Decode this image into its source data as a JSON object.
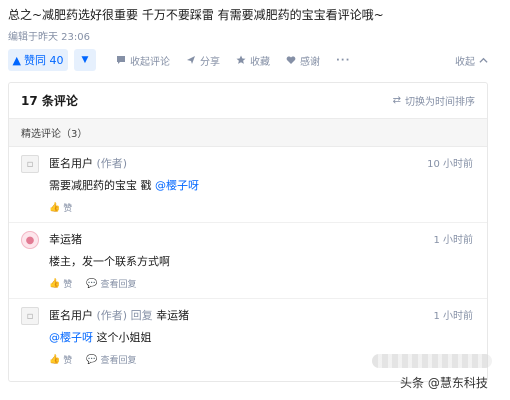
{
  "post": {
    "text": "总之~减肥药选好很重要 千万不要踩雷 有需要减肥药的宝宝看评论哦~",
    "edit_time": "编辑于昨天 23:06"
  },
  "actions": {
    "vote_up": "赞同 40",
    "vote_up_icon": "▲",
    "vote_down_icon": "▼",
    "comment": "收起评论",
    "share": "分享",
    "favorite": "收藏",
    "thanks": "感谢",
    "more": "···",
    "collapse": "收起"
  },
  "comments_section": {
    "count": "17 条评论",
    "sort": "切换为时间排序",
    "featured": "精选评论（3）",
    "items": [
      {
        "user": "匿名用户",
        "tag": "(作者)",
        "time": "10 小时前",
        "body_text": "需要减肥药的宝宝 戳",
        "mention": "@樱子呀",
        "like": "赞"
      },
      {
        "user": "幸运猪",
        "time": "1 小时前",
        "body_text": "楼主，发一个联系方式啊",
        "like": "赞",
        "reply_view": "查看回复"
      },
      {
        "user": "匿名用户",
        "tag": "(作者) 回复",
        "reply_to": "幸运猪",
        "time": "1 小时前",
        "mention": "@樱子呀",
        "body_text": " 这个小姐姐",
        "like": "赞",
        "reply_view": "查看回复"
      }
    ]
  },
  "watermark": "头条 @慧东科技",
  "colors": {
    "accent": "#0066ff",
    "muted": "#8590a6"
  }
}
